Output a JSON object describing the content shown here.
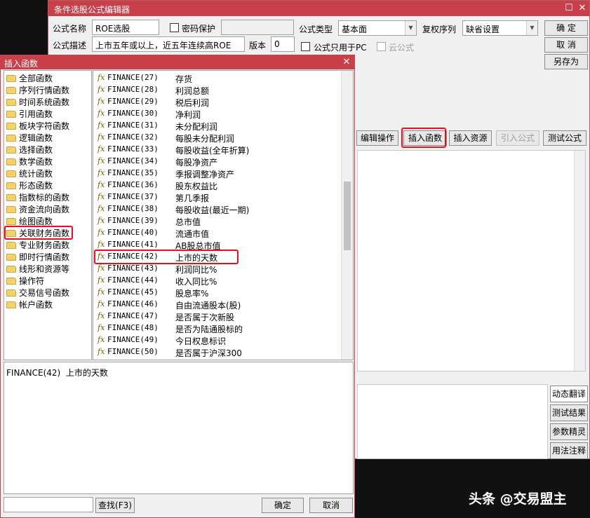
{
  "editor": {
    "title": "条件选股公式编辑器",
    "name_label": "公式名称",
    "name_value": "ROE选股",
    "password_label": "密码保护",
    "desc_label": "公式描述",
    "desc_value": "上市五年或以上，近五年连续高ROE",
    "version_label": "版本",
    "version_value": "0",
    "type_label": "公式类型",
    "type_value": "基本面",
    "adjust_label": "复权序列",
    "adjust_value": "缺省设置",
    "pc_only_label": "公式只用于PC",
    "cloud_label": "云公式",
    "ok_label": "确  定",
    "cancel_label": "取  消",
    "save_as_label": "另存为",
    "toolbar": {
      "edit_ops": "编辑操作",
      "insert_fn": "插入函数",
      "insert_res": "插入资源",
      "import_formula": "引入公式",
      "test_formula": "测试公式"
    },
    "side_tabs": [
      "动态翻译",
      "测试结果",
      "参数精灵",
      "用法注释"
    ]
  },
  "dialog": {
    "title": "插入函数",
    "categories": [
      "全部函数",
      "序列行情函数",
      "时间系统函数",
      "引用函数",
      "板块字符函数",
      "逻辑函数",
      "选择函数",
      "数学函数",
      "统计函数",
      "形态函数",
      "指数标的函数",
      "资金流向函数",
      "绘图函数",
      "关联财务函数",
      "专业财务函数",
      "即时行情函数",
      "线形和资源等",
      "操作符",
      "交易信号函数",
      "帐户函数"
    ],
    "selected_category": "关联财务函数",
    "functions": [
      {
        "code": "FINANCE(27)",
        "desc": "存货"
      },
      {
        "code": "FINANCE(28)",
        "desc": "利润总额"
      },
      {
        "code": "FINANCE(29)",
        "desc": "税后利润"
      },
      {
        "code": "FINANCE(30)",
        "desc": "净利润"
      },
      {
        "code": "FINANCE(31)",
        "desc": "未分配利润"
      },
      {
        "code": "FINANCE(32)",
        "desc": "每股未分配利润"
      },
      {
        "code": "FINANCE(33)",
        "desc": "每股收益(全年折算)"
      },
      {
        "code": "FINANCE(34)",
        "desc": "每股净资产"
      },
      {
        "code": "FINANCE(35)",
        "desc": "季报调整净资产"
      },
      {
        "code": "FINANCE(36)",
        "desc": "股东权益比"
      },
      {
        "code": "FINANCE(37)",
        "desc": "第几季报"
      },
      {
        "code": "FINANCE(38)",
        "desc": "每股收益(最近一期)"
      },
      {
        "code": "FINANCE(39)",
        "desc": "总市值"
      },
      {
        "code": "FINANCE(40)",
        "desc": "流通市值"
      },
      {
        "code": "FINANCE(41)",
        "desc": "AB股总市值"
      },
      {
        "code": "FINANCE(42)",
        "desc": "上市的天数"
      },
      {
        "code": "FINANCE(43)",
        "desc": "利润同比%"
      },
      {
        "code": "FINANCE(44)",
        "desc": "收入同比%"
      },
      {
        "code": "FINANCE(45)",
        "desc": "股息率%"
      },
      {
        "code": "FINANCE(46)",
        "desc": "自由流通股本(股)"
      },
      {
        "code": "FINANCE(47)",
        "desc": "是否属于次新股"
      },
      {
        "code": "FINANCE(48)",
        "desc": "是否为陆通股标的"
      },
      {
        "code": "FINANCE(49)",
        "desc": "今日权息标识"
      },
      {
        "code": "FINANCE(50)",
        "desc": "是否属于沪深300"
      }
    ],
    "selected_function": "FINANCE(42)",
    "detail": "FINANCE(42)  上市的天数",
    "search_value": "",
    "search_label": "查找(F3)",
    "ok_label": "确定",
    "cancel_label": "取消"
  },
  "watermark": "头条 @交易盟主",
  "colors": {
    "titlebar": "#c9404b",
    "highlight": "#e8101c",
    "folder": "#f5d36a"
  }
}
